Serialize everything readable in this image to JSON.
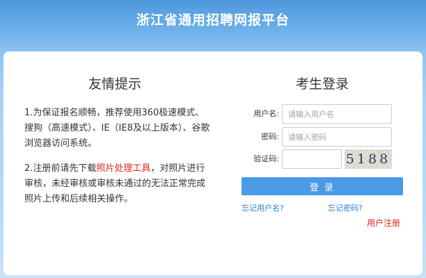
{
  "header": {
    "title": "浙江省通用招聘网报平台"
  },
  "notice": {
    "title": "友情提示",
    "tip1": "1.为保证报名顺畅，推荐使用360极速模式、搜狗（高速模式）、IE（IE8及以上版本）、谷歌浏览器访问系统。",
    "tip2_prefix": "2.注册前请先下载",
    "tip2_link": "照片处理工具",
    "tip2_suffix": "，对照片进行审核，未经审核或审核未通过的无法正常完成照片上传和后续相关操作。"
  },
  "login": {
    "title": "考生登录",
    "username_label": "用户名:",
    "username_placeholder": "请输入用户名",
    "password_label": "密码:",
    "password_placeholder": "请输入密码",
    "captcha_label": "验证码:",
    "captcha_text": "5188",
    "submit_label": "登 录",
    "forgot_username": "忘记用户名?",
    "forgot_password": "忘记密码?",
    "register": "用户注册"
  },
  "colors": {
    "accent": "#4a9ae6",
    "link_blue": "#2a7fd1",
    "link_red": "#e0211b"
  }
}
